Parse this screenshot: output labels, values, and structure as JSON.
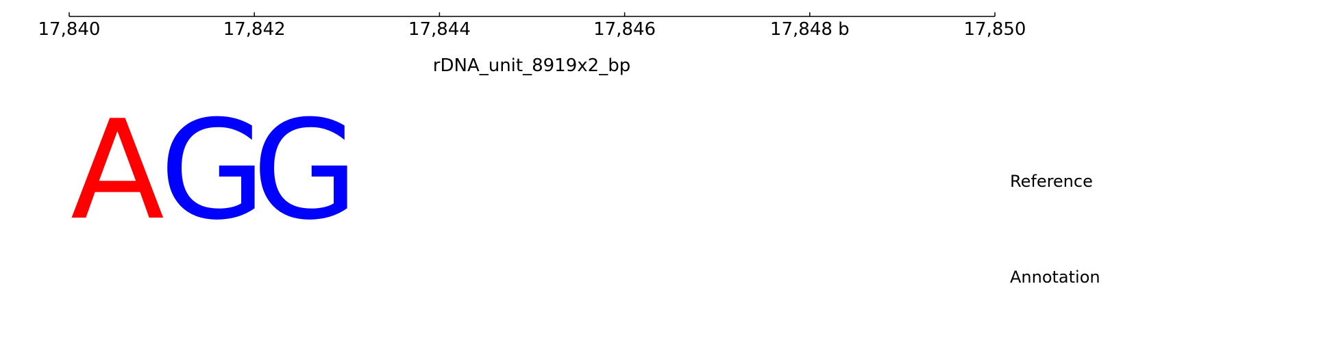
{
  "axis": {
    "title": "rDNA_unit_8919x2_bp",
    "ticks": [
      {
        "value": 17840,
        "label": "17,840"
      },
      {
        "value": 17842,
        "label": "17,842"
      },
      {
        "value": 17844,
        "label": "17,844"
      },
      {
        "value": 17846,
        "label": "17,846"
      },
      {
        "value": 17848,
        "label": "17,848 b"
      },
      {
        "value": 17850,
        "label": "17,850"
      }
    ],
    "range": [
      17840,
      17850
    ]
  },
  "reference": {
    "label": "Reference",
    "bases": [
      {
        "letter": "A",
        "color": "#ff0000"
      },
      {
        "letter": "G",
        "color": "#0000ff"
      },
      {
        "letter": "G",
        "color": "#0000ff"
      }
    ]
  },
  "annotation": {
    "label": "Annotation"
  }
}
